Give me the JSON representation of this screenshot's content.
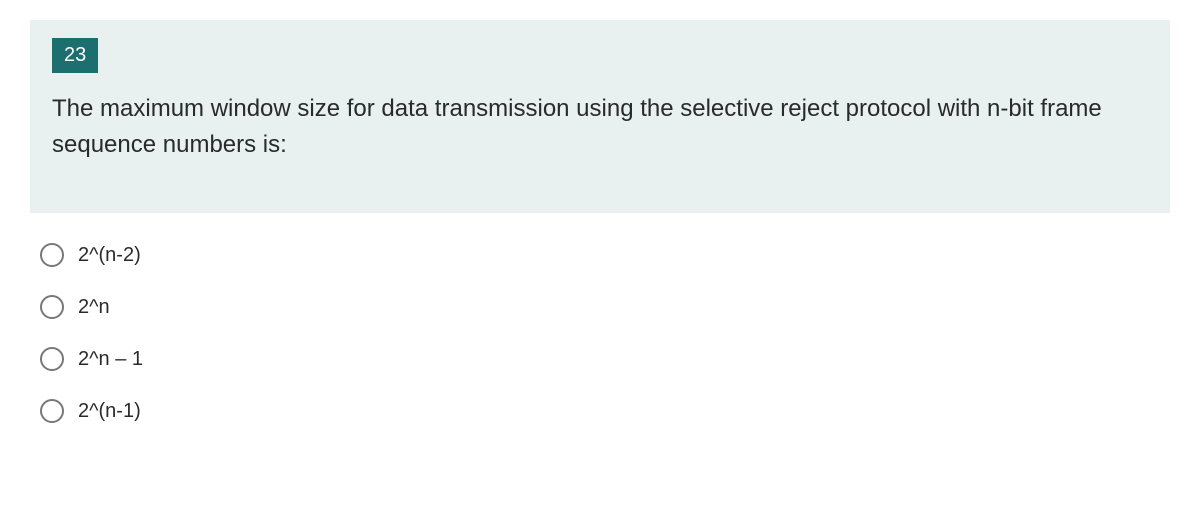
{
  "question": {
    "number": "23",
    "text": "The maximum window size for data transmission using the selective reject protocol with n-bit frame sequence numbers is:"
  },
  "options": [
    {
      "label": "2^(n-2)"
    },
    {
      "label": "2^n"
    },
    {
      "label": "2^n – 1"
    },
    {
      "label": "2^(n-1)"
    }
  ]
}
